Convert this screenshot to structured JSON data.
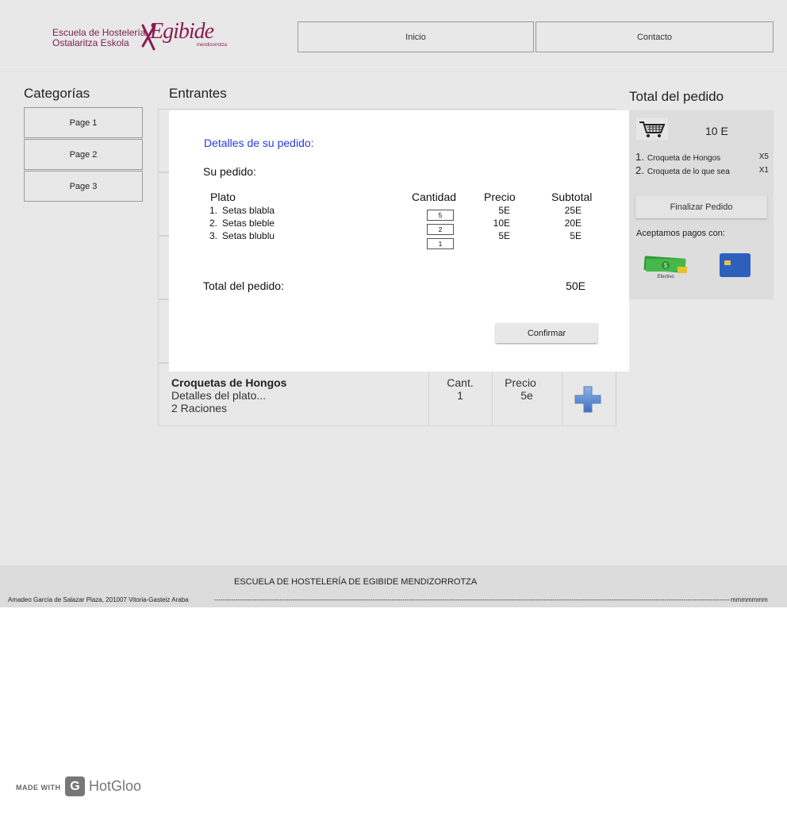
{
  "header": {
    "logo": {
      "line1": "Escuela de Hostelería",
      "line2": "Ostalaritza Eskola",
      "brand": "Egibide",
      "sub": "mendizorrotza"
    },
    "nav": [
      {
        "label": "Inicio"
      },
      {
        "label": "Contacto"
      }
    ]
  },
  "sidebar": {
    "title": "Categorías",
    "items": [
      {
        "label": "Page 1"
      },
      {
        "label": "Page 2"
      },
      {
        "label": "Page 3"
      }
    ]
  },
  "main": {
    "title": "Entrantes",
    "dish": {
      "name": "Croquetas de Hongos",
      "details": "Detalles del plato...",
      "rations": "2 Raciones",
      "qty_label": "Cant.",
      "qty_value": "1",
      "price_label": "Precio",
      "price_value": "5e",
      "add_icon": "plus-icon"
    }
  },
  "order": {
    "title": "Total del pedido",
    "cart_icon": "cart-icon",
    "amount": "10 E",
    "items": [
      {
        "num": "1.",
        "name": "Croqueta de Hongos",
        "qty": "X5"
      },
      {
        "num": "2.",
        "name": "Croqueta de lo que sea",
        "qty": "X1"
      }
    ],
    "finalize_label": "Finalizar Pedido",
    "payment_label": "Aceptamos pagos con:",
    "cash_label": "Efectivo",
    "colors": {
      "cash": "#3fae3f",
      "card": "#1f4fa8"
    }
  },
  "modal": {
    "title": "Detalles de su pedido:",
    "subtitle": "Su pedido:",
    "columns": {
      "dish": "Plato",
      "qty": "Cantidad",
      "price": "Precio",
      "subtotal": "Subtotal"
    },
    "items": [
      {
        "num": "1.",
        "name": "Setas blabla",
        "qty": "5",
        "price": "5E",
        "subtotal": "25E"
      },
      {
        "num": "2.",
        "name": "Setas bleble",
        "qty": "2",
        "price": "10E",
        "subtotal": "20E"
      },
      {
        "num": "3.",
        "name": "Setas blublu",
        "qty": "1",
        "price": "5E",
        "subtotal": "5E"
      }
    ],
    "total_label": "Total del pedido:",
    "total_value": "50E",
    "confirm_label": "Confirmar",
    "title_color": "#2a3ae0"
  },
  "footer": {
    "title": "ESCUELA DE HOSTELERÍA DE EGIBIDE MENDIZORROTZA",
    "address": "Amadeo García de Salazar Plaza, 201007 Vitoria-Gasteiz Araba",
    "dashes": "--------------------------------------------------------------------------------------------------------------------------------------------------------------------------------------------------------------------------------------------------------------------",
    "tail": "mmmmmmm"
  },
  "badge": {
    "made_with": "MADE WITH",
    "brand": "HotGloo"
  }
}
